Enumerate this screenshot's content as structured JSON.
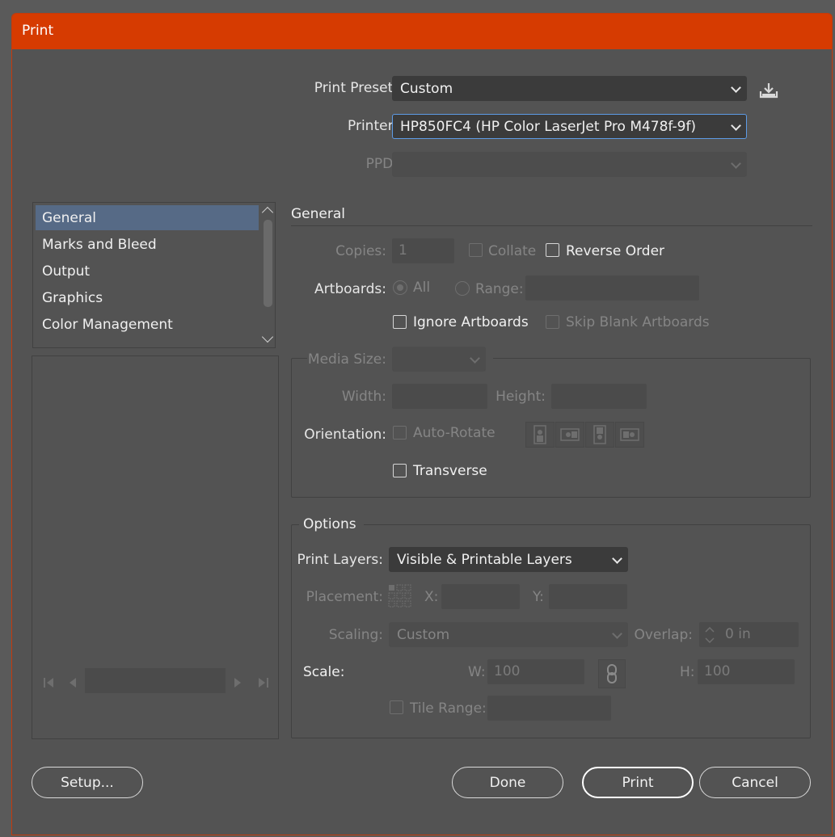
{
  "window": {
    "title": "Print"
  },
  "top": {
    "print_preset_label": "Print Preset:",
    "print_preset_value": "Custom",
    "printer_label": "Printer:",
    "printer_value": "HP850FC4 (HP Color LaserJet Pro M478f-9f)",
    "ppd_label": "PPD:",
    "ppd_value": ""
  },
  "sidebar": {
    "items": [
      {
        "label": "General",
        "selected": true
      },
      {
        "label": "Marks and Bleed"
      },
      {
        "label": "Output"
      },
      {
        "label": "Graphics"
      },
      {
        "label": "Color Management"
      }
    ]
  },
  "general": {
    "heading": "General",
    "copies_label": "Copies:",
    "copies_value": "1",
    "collate_label": "Collate",
    "reverse_order_label": "Reverse Order",
    "artboards_label": "Artboards:",
    "all_label": "All",
    "range_label": "Range:",
    "ignore_artboards_label": "Ignore Artboards",
    "skip_blank_label": "Skip Blank Artboards"
  },
  "media": {
    "media_size_label": "Media Size:",
    "width_label": "Width:",
    "height_label": "Height:",
    "orientation_label": "Orientation:",
    "auto_rotate_label": "Auto-Rotate",
    "transverse_label": "Transverse"
  },
  "options": {
    "heading": "Options",
    "print_layers_label": "Print Layers:",
    "print_layers_value": "Visible & Printable Layers",
    "placement_label": "Placement:",
    "x_label": "X:",
    "y_label": "Y:",
    "scaling_label": "Scaling:",
    "scaling_value": "Custom",
    "overlap_label": "Overlap:",
    "overlap_value": "0 in",
    "scale_label": "Scale:",
    "w_label": "W:",
    "w_value": "100",
    "h_label": "H:",
    "h_value": "100",
    "tile_range_label": "Tile Range:"
  },
  "buttons": {
    "setup": "Setup...",
    "done": "Done",
    "print": "Print",
    "cancel": "Cancel"
  }
}
